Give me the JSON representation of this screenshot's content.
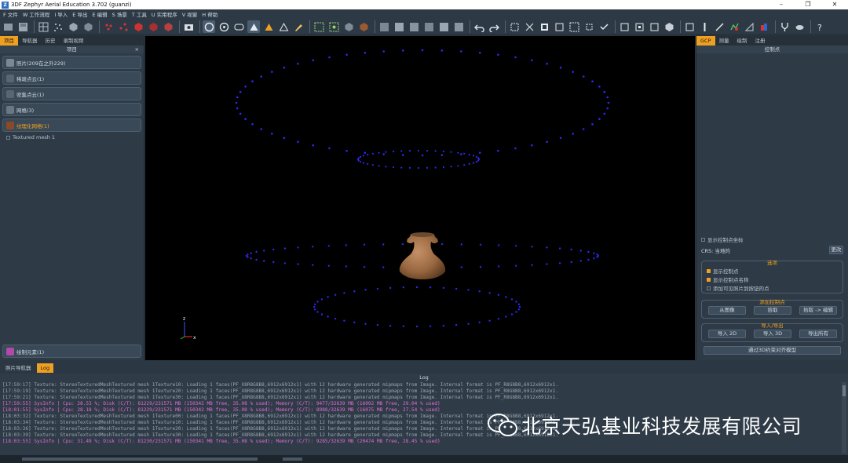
{
  "title": {
    "icon": "Z",
    "text": "3DF Zephyr Aerial Education 3.702 (guanzi)"
  },
  "window_controls": [
    "–",
    "❐",
    "✕"
  ],
  "menu": [
    "F 文件",
    "W 工作流程",
    "I 导入",
    "E 导出",
    "E 编辑",
    "S 场景",
    "T 工具",
    "U 实用程序",
    "V 视窗",
    "H 帮助"
  ],
  "left_panel": {
    "tabs": [
      "项目",
      "导航器",
      "历史",
      "录制视频"
    ],
    "header": "项目",
    "close": "×",
    "items": [
      {
        "label": "照片(209在之外229)"
      },
      {
        "label": "稀疏点云(1)"
      },
      {
        "label": "密集点云(1)"
      },
      {
        "label": "网格(3)"
      },
      {
        "label": "纹理化网格(1)"
      }
    ],
    "sub_item": "Textured mesh 1",
    "bottom_item": "绘制元素(1)"
  },
  "right_panel": {
    "tabs": [
      "GCP",
      "测量",
      "绘制",
      "注册"
    ],
    "header": "控制点",
    "show_coords": "显示控制点坐标",
    "crs_label": "CRS: 当地的",
    "crs_button": "更改",
    "options": {
      "title": "选项",
      "show_points": "显示控制点",
      "show_names": "显示控制点名称",
      "add_visible": "添加可见照片到按钮的点"
    },
    "add_points": {
      "title": "添加控制点",
      "from_image": "从图像",
      "pick": "拾取",
      "pick_edit": "拾取 -> 编辑"
    },
    "import_export": {
      "title": "导入/导出",
      "import_2d": "导入 2D",
      "import_3d": "导入 3D",
      "export_all": "导出所有"
    },
    "scale_button": "通过3D约束对齐模型"
  },
  "bottom_tabs": [
    "照片导航器",
    "Log"
  ],
  "log": {
    "header": "Log",
    "close": "×",
    "lines": [
      {
        "kind": "normal",
        "text": "[17:59:17] Texture: StereoTexturedMeshTextured mesh 1Texture10: Loading 1 faces(PF_X8R8G8B8,6912x6912x1) with 12 hardware generated mipmaps from Image. Internal format is PF_R8G8B8,6912x6912x1."
      },
      {
        "kind": "normal",
        "text": "[17:59:19] Texture: StereoTexturedMeshTextured mesh 1Texture20: Loading 1 faces(PF_X8R8G8B8,6912x6912x1) with 12 hardware generated mipmaps from Image. Internal format is PF_R8G8B8,6912x6912x1."
      },
      {
        "kind": "normal",
        "text": "[17:59:21] Texture: StereoTexturedMeshTextured mesh 1Texture30: Loading 1 faces(PF_X8R8G8B8,6912x6912x1) with 12 hardware generated mipmaps from Image. Internal format is PF_R8G8B8,6912x6912x1."
      },
      {
        "kind": "sys",
        "text": "[17:59:55] SysInfo | Cpu: 28.53 %; Disk (C/T): 81229/231571 MB (150342 MB free, 35.08 % used); Memory (C/T): 9477/32639 MB (16092 MB free, 29.04 % used)"
      },
      {
        "kind": "sys",
        "text": "[18:01:55] SysInfo | Cpu: 28.18 %; Disk (C/T): 81229/231571 MB (150342 MB free, 35.08 % used); Memory (C/T): 8988/32639 MB (16075 MB free, 27.54 % used)"
      },
      {
        "kind": "normal",
        "text": "[18:03:32] Texture: StereoTexturedMeshTextured mesh 1Texture00: Loading 1 faces(PF_X8R8G8B8,6912x6912x1) with 12 hardware generated mipmaps from Image. Internal format is PF_R8G8B8,6912x6912x1."
      },
      {
        "kind": "normal",
        "text": "[18:03:34] Texture: StereoTexturedMeshTextured mesh 1Texture10: Loading 1 faces(PF_X8R8G8B8,6912x6912x1) with 12 hardware generated mipmaps from Image. Internal format is PF_R8G8B8,6912x6912x1."
      },
      {
        "kind": "normal",
        "text": "[18:03:36] Texture: StereoTexturedMeshTextured mesh 1Texture20: Loading 1 faces(PF_X8R8G8B8,6912x6912x1) with 12 hardware generated mipmaps from Image. Internal format is PF_R8G8B8,6912x6912x1."
      },
      {
        "kind": "normal",
        "text": "[18:03:39] Texture: StereoTexturedMeshTextured mesh 1Texture30: Loading 1 faces(PF_X8R8G8B8,6912x6912x1) with 12 hardware generated mipmaps from Image. Internal format is PF_R8G8B8,6912x6912x1."
      },
      {
        "kind": "sys",
        "text": "[18:03:55] SysInfo | Cpu: 31.49 %; Disk (C/T): 81230/231571 MB (150341 MB free, 35.08 % used); Memory (C/T): 9285/32639 MB (20474 MB free, 28.45 % used)"
      }
    ]
  },
  "watermark": "北京天弘基业科技发展有限公司",
  "axis": {
    "z": "z",
    "x": "x"
  },
  "colors": {
    "accent": "#f0a020",
    "sysinfo": "#e36ad6",
    "camera_point": "#2a2af0"
  }
}
